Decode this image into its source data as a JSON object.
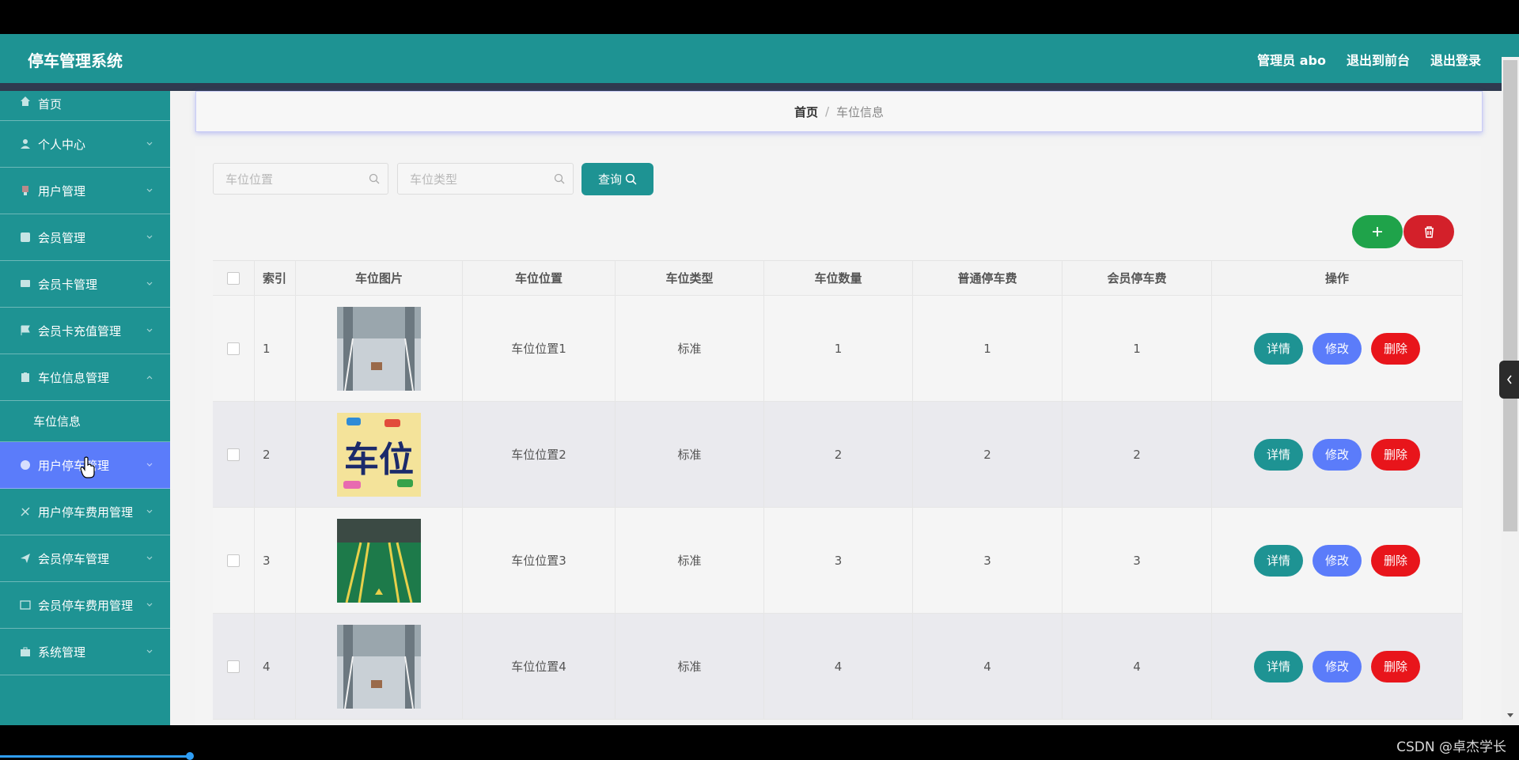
{
  "app": {
    "title": "停车管理系统",
    "user_label": "管理员 abo",
    "to_front_label": "退出到前台",
    "logout_label": "退出登录"
  },
  "sidebar": {
    "items": [
      {
        "label": "首页",
        "icon": "home-icon"
      },
      {
        "label": "个人中心",
        "icon": "user-icon"
      },
      {
        "label": "用户管理",
        "icon": "users-icon"
      },
      {
        "label": "会员管理",
        "icon": "member-icon"
      },
      {
        "label": "会员卡管理",
        "icon": "card-icon"
      },
      {
        "label": "会员卡充值管理",
        "icon": "flag-icon"
      },
      {
        "label": "车位信息管理",
        "icon": "clipboard-icon"
      },
      {
        "label": "用户停车管理",
        "icon": "parking-icon"
      },
      {
        "label": "用户停车费用管理",
        "icon": "fee-icon"
      },
      {
        "label": "会员停车管理",
        "icon": "send-icon"
      },
      {
        "label": "会员停车费用管理",
        "icon": "bill-icon"
      },
      {
        "label": "系统管理",
        "icon": "briefcase-icon"
      }
    ],
    "sub_items": [
      {
        "label": "车位信息"
      }
    ]
  },
  "breadcrumb": {
    "home": "首页",
    "separator": "/",
    "current": "车位信息"
  },
  "search": {
    "location_placeholder": "车位位置",
    "type_placeholder": "车位类型",
    "query_label": "查询"
  },
  "table": {
    "headers": [
      "索引",
      "车位图片",
      "车位位置",
      "车位类型",
      "车位数量",
      "普通停车费",
      "会员停车费",
      "操作"
    ],
    "rows": [
      {
        "index": "1",
        "image": "parking-garage-photo",
        "location": "车位位置1",
        "type": "标准",
        "count": "1",
        "normal_fee": "1",
        "member_fee": "1"
      },
      {
        "index": "2",
        "image": "parking-sign-graphic",
        "location": "车位位置2",
        "type": "标准",
        "count": "2",
        "normal_fee": "2",
        "member_fee": "2"
      },
      {
        "index": "3",
        "image": "green-parking-lot-photo",
        "location": "车位位置3",
        "type": "标准",
        "count": "3",
        "normal_fee": "3",
        "member_fee": "3"
      },
      {
        "index": "4",
        "image": "parking-garage-photo",
        "location": "车位位置4",
        "type": "标准",
        "count": "4",
        "normal_fee": "4",
        "member_fee": "4"
      }
    ],
    "actions": {
      "detail": "详情",
      "edit": "修改",
      "delete": "删除"
    }
  },
  "thumbnail_text": {
    "parking_sign": "车位"
  },
  "watermark": "CSDN @卓杰学长",
  "colors": {
    "primary": "#1e9393",
    "active": "#5b7cfa",
    "success": "#1fa34a",
    "danger": "#d3202a",
    "delete": "#e8151b"
  }
}
